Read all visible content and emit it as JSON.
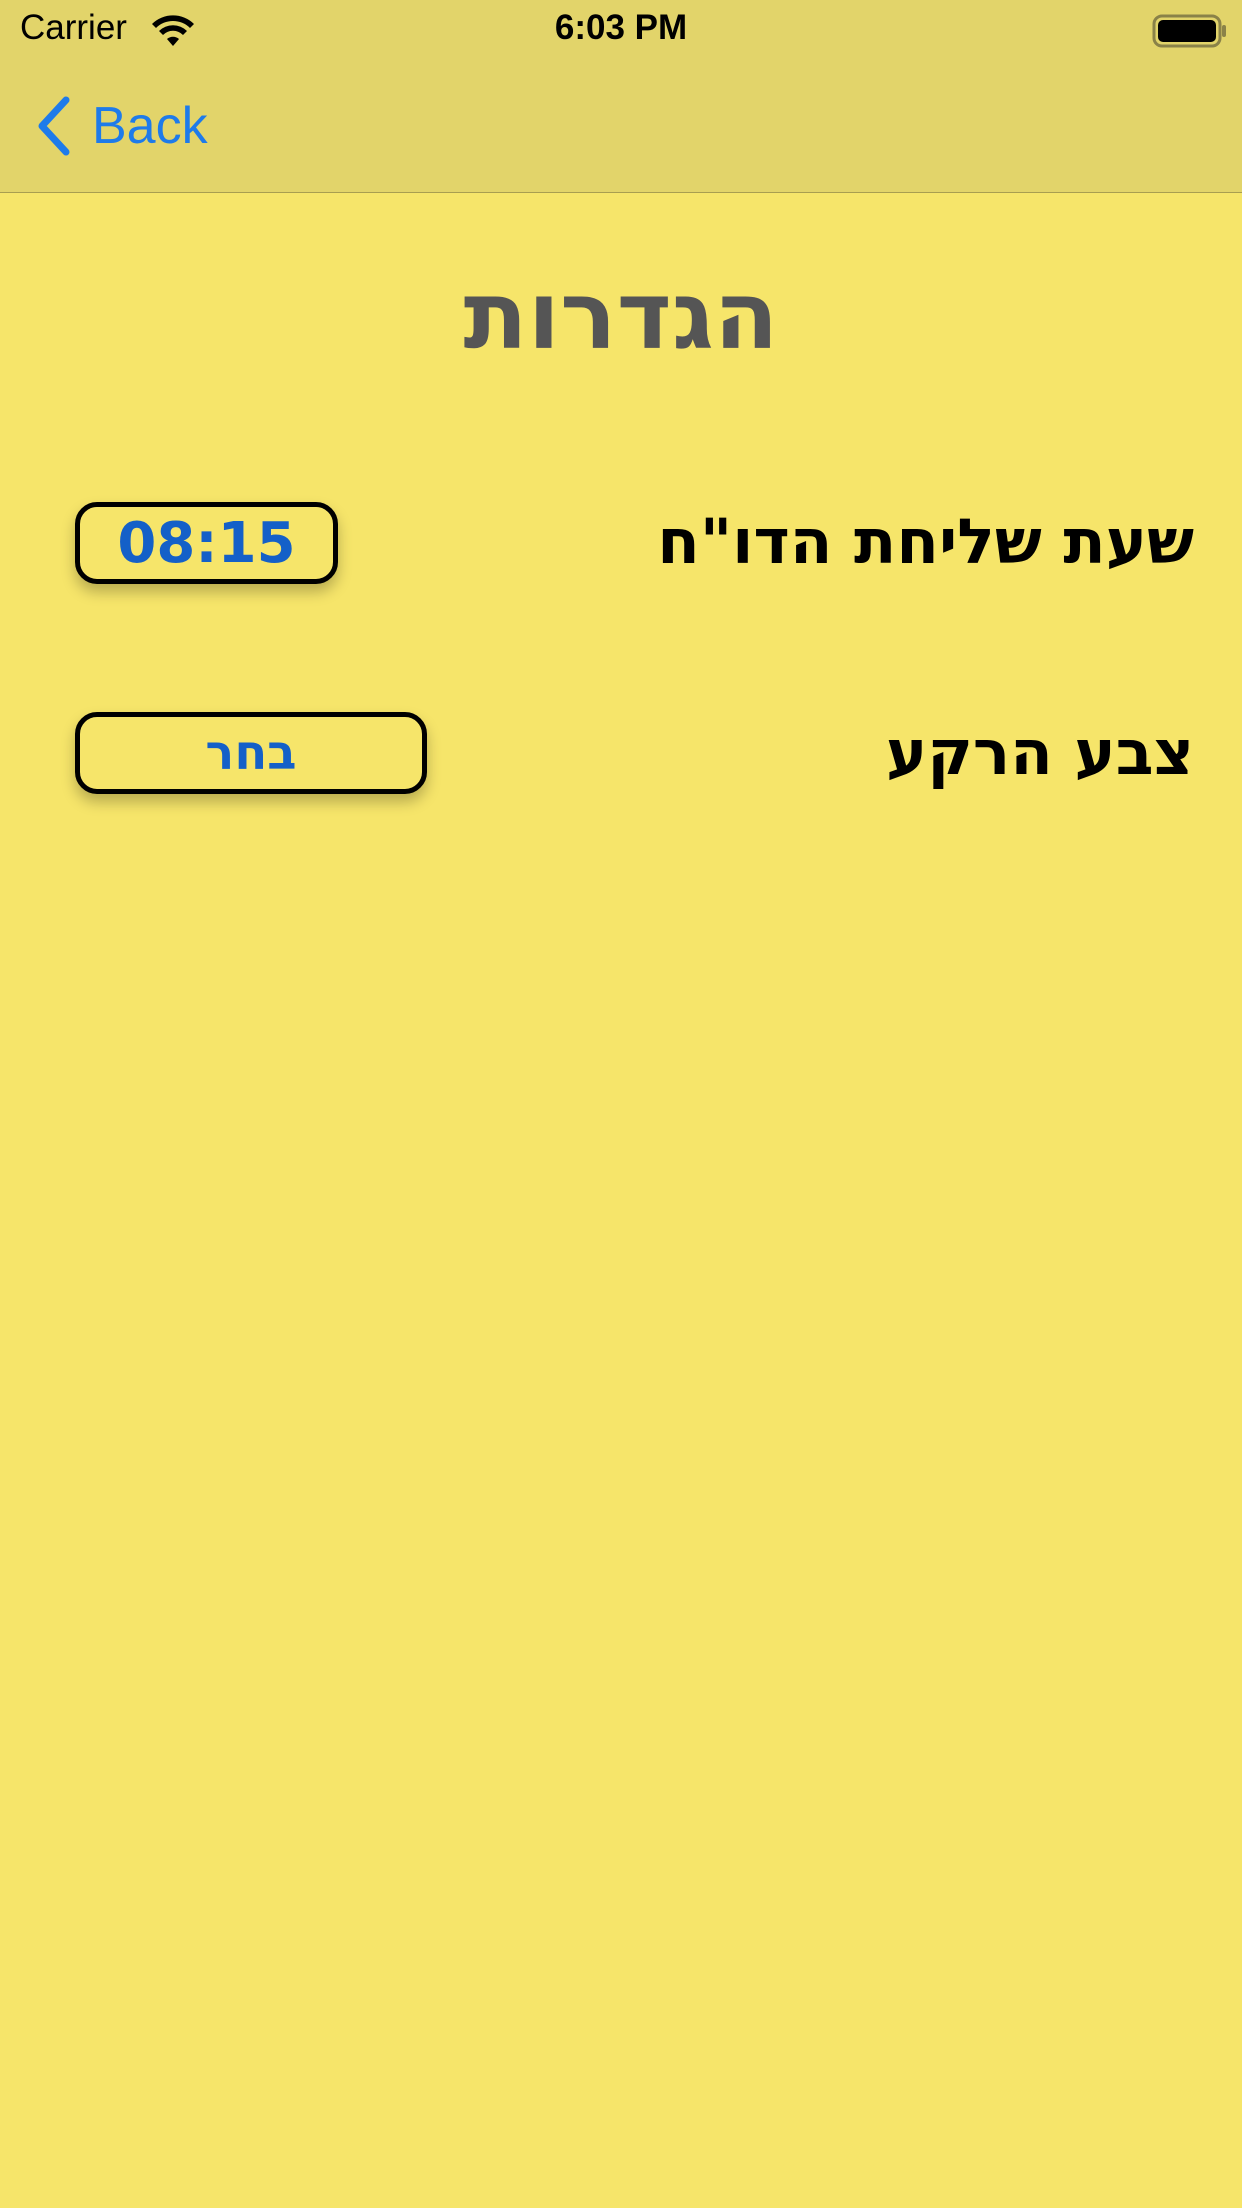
{
  "status_bar": {
    "carrier": "Carrier",
    "time": "6:03 PM"
  },
  "nav": {
    "back_label": "Back",
    "back_icon": "chevron-left-icon"
  },
  "page": {
    "title": "הגדרות"
  },
  "settings": {
    "report_time_label": "שעת שליחת הדו\"ח",
    "report_time_value": "08:15",
    "background_color_label": "צבע הרקע",
    "background_color_button": "בחר"
  },
  "colors": {
    "background": "#F6E56A",
    "nav_bar": "#E2D46A",
    "accent": "#1E7BEA",
    "button_text": "#1460C8",
    "title_text": "#555555"
  }
}
